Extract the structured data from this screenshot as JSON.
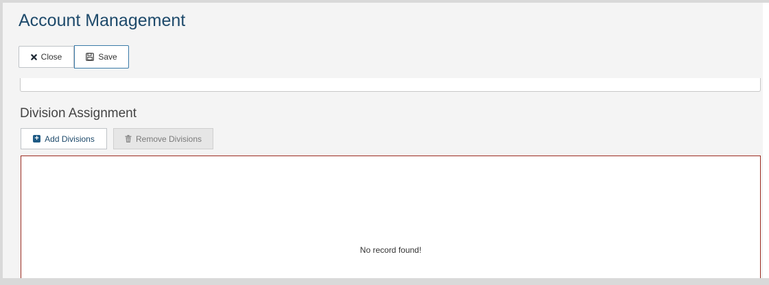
{
  "header": {
    "title": "Account Management"
  },
  "toolbar": {
    "close_label": "Close",
    "save_label": "Save"
  },
  "division": {
    "title": "Division Assignment",
    "add_label": "Add Divisions",
    "remove_label": "Remove Divisions",
    "empty_message": "No record found!"
  },
  "icons": {
    "close": "close-icon",
    "save": "floppy-disk-icon",
    "add": "plus-square-icon",
    "remove": "trash-icon"
  },
  "colors": {
    "title": "#1e4a6b",
    "grid_border": "#9b2a1f",
    "add_icon": "#1e5a84",
    "panel_background": "#f4f4f4"
  }
}
